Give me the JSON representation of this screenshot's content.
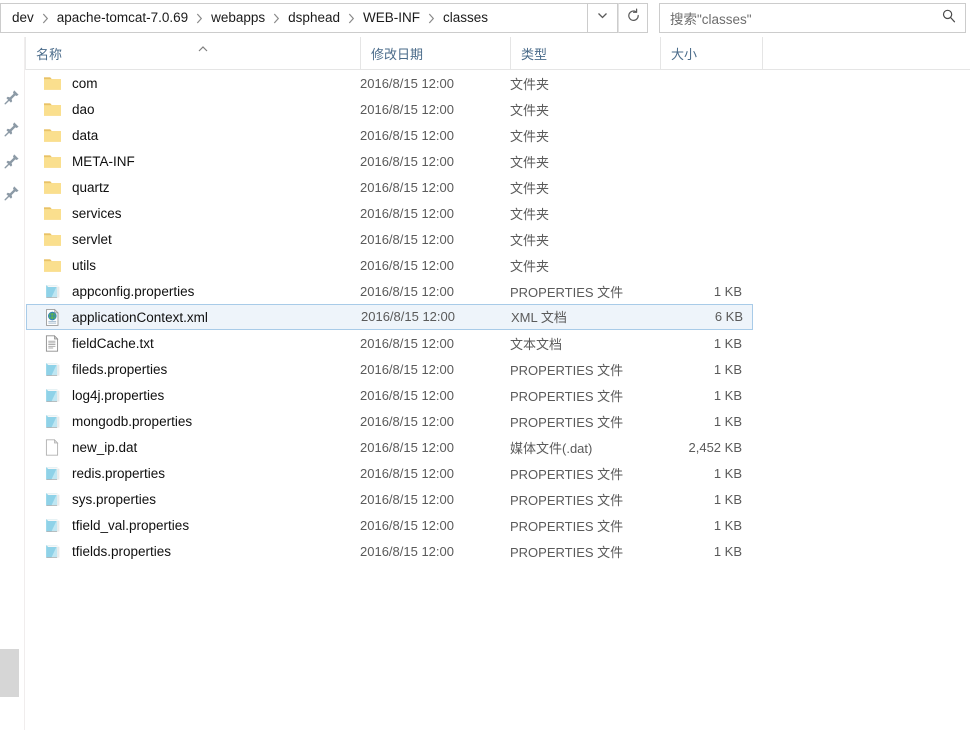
{
  "addressbar": {
    "breadcrumb": [
      "dev",
      "apache-tomcat-7.0.69",
      "webapps",
      "dsphead",
      "WEB-INF",
      "classes"
    ],
    "dropdown_icon": "chevron-down-icon",
    "refresh_icon": "refresh-icon",
    "search_placeholder": "搜索\"classes\"",
    "search_icon": "search-icon",
    "search_value": ""
  },
  "navpane": {
    "pin_icon": "pushpin-icon",
    "pin_count": 4
  },
  "columns": {
    "name": "名称",
    "date_modified": "修改日期",
    "type": "类型",
    "size": "大小",
    "sort_column": "名称",
    "sort_direction": "ascending"
  },
  "colors": {
    "selection_fill": "#eef4fa",
    "selection_border": "#a8cbe8",
    "header_text": "#4a6b8a",
    "folder_icon": "#f5d372",
    "properties_icon": "#9fd8e8"
  },
  "files": [
    {
      "name": "com",
      "icon": "folder-icon",
      "date": "2016/8/15 12:00",
      "type": "文件夹",
      "size": "",
      "selected": false
    },
    {
      "name": "dao",
      "icon": "folder-icon",
      "date": "2016/8/15 12:00",
      "type": "文件夹",
      "size": "",
      "selected": false
    },
    {
      "name": "data",
      "icon": "folder-icon",
      "date": "2016/8/15 12:00",
      "type": "文件夹",
      "size": "",
      "selected": false
    },
    {
      "name": "META-INF",
      "icon": "folder-icon",
      "date": "2016/8/15 12:00",
      "type": "文件夹",
      "size": "",
      "selected": false
    },
    {
      "name": "quartz",
      "icon": "folder-icon",
      "date": "2016/8/15 12:00",
      "type": "文件夹",
      "size": "",
      "selected": false
    },
    {
      "name": "services",
      "icon": "folder-icon",
      "date": "2016/8/15 12:00",
      "type": "文件夹",
      "size": "",
      "selected": false
    },
    {
      "name": "servlet",
      "icon": "folder-icon",
      "date": "2016/8/15 12:00",
      "type": "文件夹",
      "size": "",
      "selected": false
    },
    {
      "name": "utils",
      "icon": "folder-icon",
      "date": "2016/8/15 12:00",
      "type": "文件夹",
      "size": "",
      "selected": false
    },
    {
      "name": "appconfig.properties",
      "icon": "properties-icon",
      "date": "2016/8/15 12:00",
      "type": "PROPERTIES 文件",
      "size": "1 KB",
      "selected": false
    },
    {
      "name": "applicationContext.xml",
      "icon": "xml-icon",
      "date": "2016/8/15 12:00",
      "type": "XML 文档",
      "size": "6 KB",
      "selected": true
    },
    {
      "name": "fieldCache.txt",
      "icon": "text-icon",
      "date": "2016/8/15 12:00",
      "type": "文本文档",
      "size": "1 KB",
      "selected": false
    },
    {
      "name": "fileds.properties",
      "icon": "properties-icon",
      "date": "2016/8/15 12:00",
      "type": "PROPERTIES 文件",
      "size": "1 KB",
      "selected": false
    },
    {
      "name": "log4j.properties",
      "icon": "properties-icon",
      "date": "2016/8/15 12:00",
      "type": "PROPERTIES 文件",
      "size": "1 KB",
      "selected": false
    },
    {
      "name": "mongodb.properties",
      "icon": "properties-icon",
      "date": "2016/8/15 12:00",
      "type": "PROPERTIES 文件",
      "size": "1 KB",
      "selected": false
    },
    {
      "name": "new_ip.dat",
      "icon": "blank-file-icon",
      "date": "2016/8/15 12:00",
      "type": "媒体文件(.dat)",
      "size": "2,452 KB",
      "selected": false
    },
    {
      "name": "redis.properties",
      "icon": "properties-icon",
      "date": "2016/8/15 12:00",
      "type": "PROPERTIES 文件",
      "size": "1 KB",
      "selected": false
    },
    {
      "name": "sys.properties",
      "icon": "properties-icon",
      "date": "2016/8/15 12:00",
      "type": "PROPERTIES 文件",
      "size": "1 KB",
      "selected": false
    },
    {
      "name": "tfield_val.properties",
      "icon": "properties-icon",
      "date": "2016/8/15 12:00",
      "type": "PROPERTIES 文件",
      "size": "1 KB",
      "selected": false
    },
    {
      "name": "tfields.properties",
      "icon": "properties-icon",
      "date": "2016/8/15 12:00",
      "type": "PROPERTIES 文件",
      "size": "1 KB",
      "selected": false
    }
  ]
}
